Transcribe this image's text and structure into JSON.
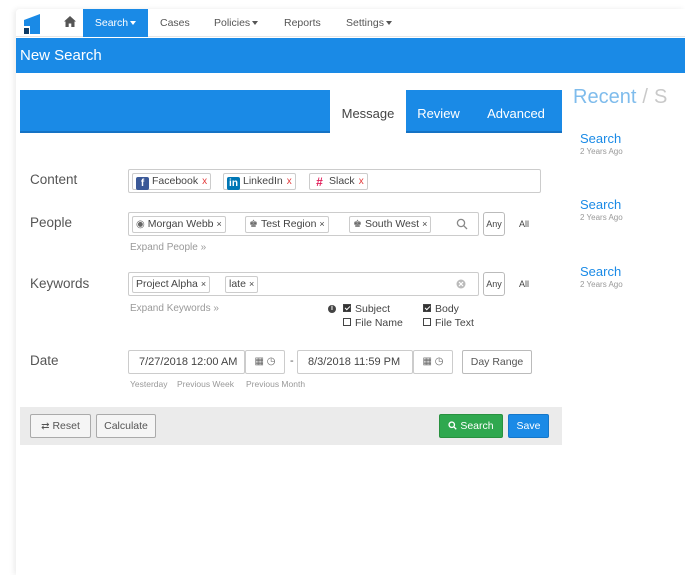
{
  "nav": {
    "items": [
      {
        "label": "Search"
      },
      {
        "label": "Cases"
      },
      {
        "label": "Policies"
      },
      {
        "label": "Reports"
      },
      {
        "label": "Settings"
      }
    ]
  },
  "page": {
    "title": "New Search"
  },
  "tabs": [
    {
      "label": "Message",
      "active": true
    },
    {
      "label": "Review",
      "active": false
    },
    {
      "label": "Advanced",
      "active": false
    }
  ],
  "form": {
    "content": {
      "label": "Content",
      "chips": [
        {
          "label": "Facebook",
          "icon": "facebook-icon",
          "color": "#3b5998",
          "remove": "x"
        },
        {
          "label": "LinkedIn",
          "icon": "linkedin-icon",
          "color": "#0077b5",
          "remove": "x"
        },
        {
          "label": "Slack",
          "icon": "slack-icon",
          "color": "#4a154b",
          "remove": "x"
        }
      ]
    },
    "people": {
      "label": "People",
      "chips": [
        {
          "label": "Morgan Webb",
          "icon": "user-icon",
          "remove": "×"
        },
        {
          "label": "Test Region",
          "icon": "group-icon",
          "remove": "×"
        },
        {
          "label": "South West",
          "icon": "group-icon",
          "remove": "×"
        }
      ],
      "any_label": "Any",
      "all_label": "All",
      "expand_link": "Expand People »"
    },
    "keywords": {
      "label": "Keywords",
      "chips": [
        {
          "label": "Project Alpha",
          "remove": "×"
        },
        {
          "label": "late",
          "remove": "×"
        }
      ],
      "any_label": "Any",
      "all_label": "All",
      "expand_link": "Expand Keywords »",
      "options": [
        {
          "label": "Subject",
          "checked": true
        },
        {
          "label": "Body",
          "checked": true
        },
        {
          "label": "File Name",
          "checked": false
        },
        {
          "label": "File Text",
          "checked": false
        }
      ]
    },
    "date": {
      "label": "Date",
      "from": "7/27/2018 12:00 AM",
      "separator": "-",
      "to": "8/3/2018 11:59 PM",
      "range_button": "Day Range",
      "quick_links": [
        "Yesterday",
        "Previous Week",
        "Previous Month"
      ]
    }
  },
  "actions": {
    "reset": "Reset",
    "calculate": "Calculate",
    "search": "Search",
    "save": "Save"
  },
  "recent": {
    "title": "Recent",
    "separator": "/",
    "next_tab_partial": "S",
    "items": [
      {
        "name": "Search",
        "when": "2 Years Ago"
      },
      {
        "name": "Search",
        "when": "2 Years Ago"
      },
      {
        "name": "Search",
        "when": "2 Years Ago"
      }
    ]
  },
  "colors": {
    "primary": "#1a8ae6",
    "success": "#2fa84f",
    "remove_red": "#e23c3c"
  }
}
